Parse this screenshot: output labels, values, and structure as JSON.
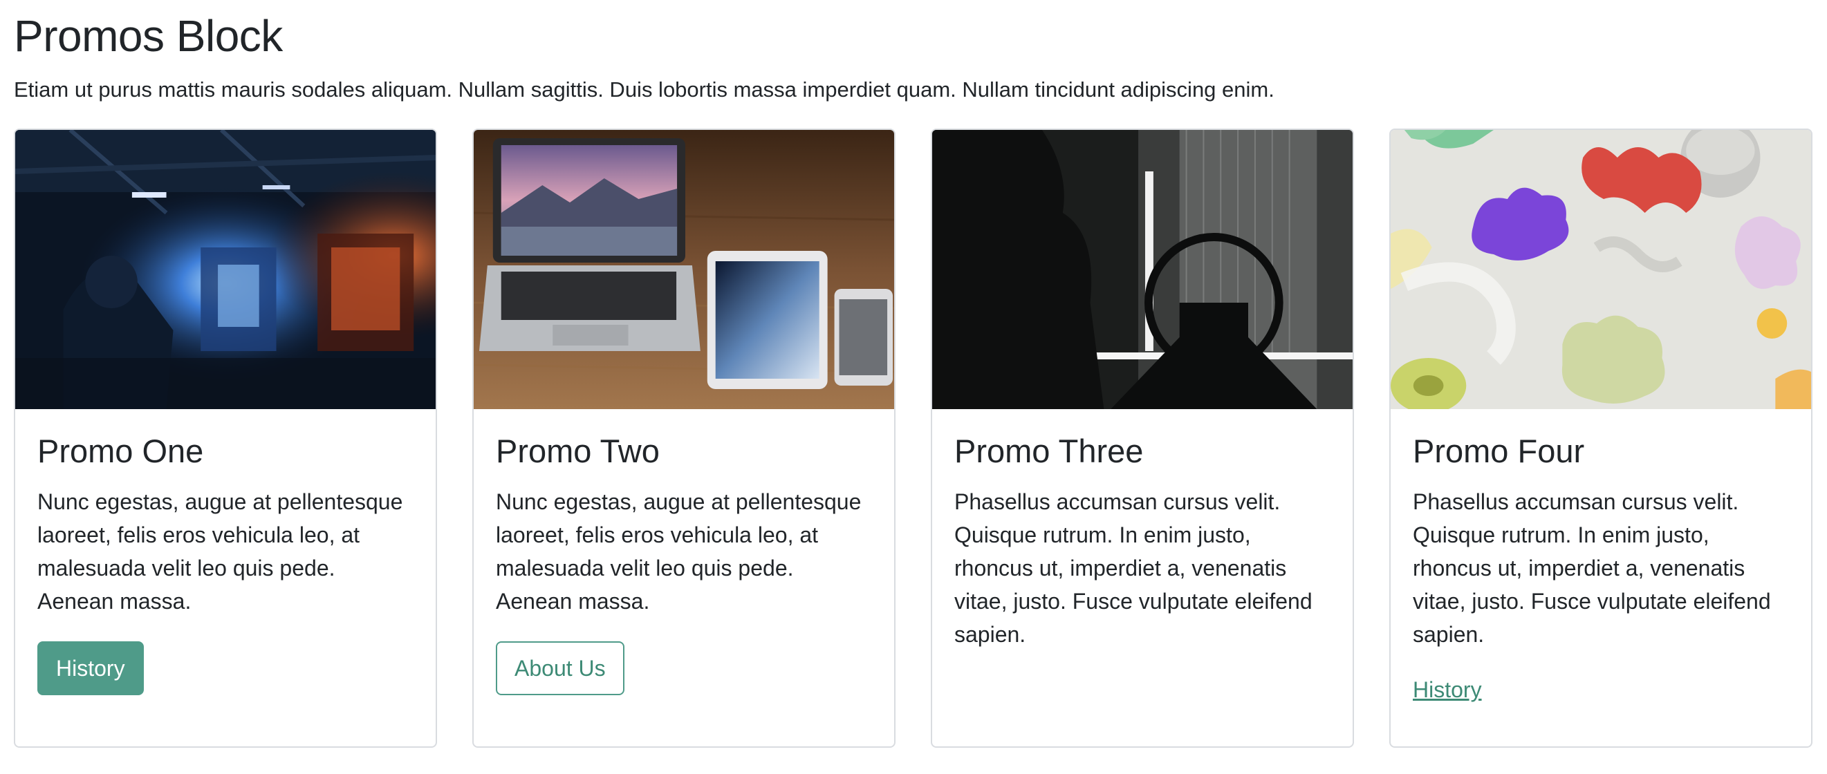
{
  "page": {
    "title": "Promos Block",
    "intro": "Etiam ut purus mattis mauris sodales aliquam. Nullam sagittis. Duis lobortis massa imperdiet quam. Nullam tincidunt adipiscing enim."
  },
  "colors": {
    "accent": "#4f9b89",
    "text": "#212529",
    "border": "#d9dce0"
  },
  "promos": [
    {
      "title": "Promo One",
      "text": "Nunc egestas, augue at pellentesque laoreet, felis eros vehicula leo, at malesuada velit leo quis pede. Aenean massa.",
      "action_label": "History",
      "action_style": "solid-button",
      "image": "workshop-photo"
    },
    {
      "title": "Promo Two",
      "text": "Nunc egestas, augue at pellentesque laoreet, felis eros vehicula leo, at malesuada velit leo quis pede. Aenean massa.",
      "action_label": "About Us",
      "action_style": "outline-button",
      "image": "devices-photo"
    },
    {
      "title": "Promo Three",
      "text": "Phasellus accumsan cursus velit. Quisque rutrum. In enim justo, rhoncus ut, imperdiet a, venenatis vitae, justo. Fusce vulputate eleifend sapien.",
      "action_label": "",
      "action_style": "none",
      "image": "studio-photo"
    },
    {
      "title": "Promo Four",
      "text": "Phasellus accumsan cursus velit. Quisque rutrum. In enim justo, rhoncus ut, imperdiet a, venenatis vitae, justo. Fusce vulputate eleifend sapien.",
      "action_label": "History",
      "action_style": "link",
      "image": "shapes-photo"
    }
  ]
}
